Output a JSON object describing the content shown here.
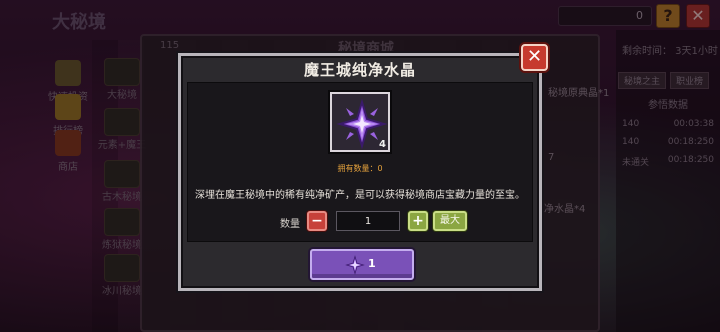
{
  "background": {
    "title": "大秘境",
    "currency_value": "0",
    "help_label": "?",
    "close_label": "✕",
    "sidebar": [
      {
        "label": "快速投资"
      },
      {
        "label": "排行榜"
      },
      {
        "label": "商店"
      }
    ],
    "tiers": [
      "大秘境",
      "元素+魔王",
      "古木秘境",
      "炼狱秘境",
      "冰川秘境"
    ],
    "shop_title": "秘境商城",
    "shop_counter": "115",
    "shop_item_a": "秘境原典晶*1",
    "shop_item_a_qty": "7",
    "shop_item_b": "净水晶*4",
    "remaining_time": "剩余时间： 3天1小时",
    "right_tabs": [
      "秘境之主",
      "职业榜"
    ],
    "ranking_header": "参悟数据",
    "ranking_rows": [
      {
        "num": "140",
        "time": "00:03:38"
      },
      {
        "num": "140",
        "time": "00:18:250"
      },
      {
        "num": "未通关",
        "time": "00:18:250"
      }
    ]
  },
  "modal": {
    "title": "魔王城纯净水晶",
    "close_label": "✕",
    "item_icon": "purple-crystal-star-icon",
    "item_count": "4",
    "owned_text": "拥有数量：0",
    "description": "深埋在魔王秘境中的稀有纯净矿产，是可以获得秘境商店宝藏力量的至宝。",
    "quantity_label": "数量",
    "minus_label": "−",
    "plus_label": "+",
    "quantity_value": "1",
    "max_label": "最大",
    "price": "1",
    "price_icon": "purple-crystal-star-icon"
  },
  "colors": {
    "modal_border": "#b9b5bb",
    "close_red": "#c63a2e",
    "owned_orange": "#e3a03c",
    "plus_green": "#8ba642",
    "buy_purple": "#7a51b8"
  }
}
